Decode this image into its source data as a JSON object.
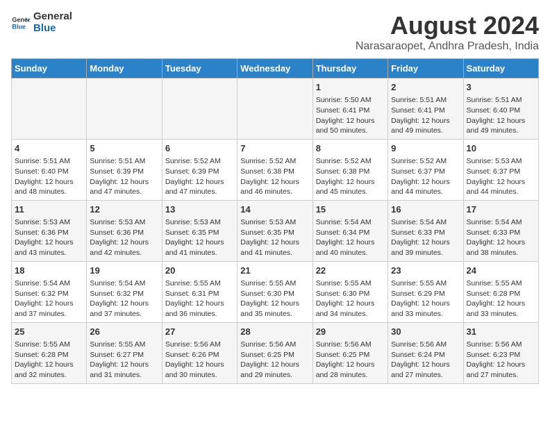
{
  "logo": {
    "line1": "General",
    "line2": "Blue"
  },
  "title": "August 2024",
  "subtitle": "Narasaraopet, Andhra Pradesh, India",
  "headers": [
    "Sunday",
    "Monday",
    "Tuesday",
    "Wednesday",
    "Thursday",
    "Friday",
    "Saturday"
  ],
  "weeks": [
    [
      {
        "day": "",
        "content": ""
      },
      {
        "day": "",
        "content": ""
      },
      {
        "day": "",
        "content": ""
      },
      {
        "day": "",
        "content": ""
      },
      {
        "day": "1",
        "content": "Sunrise: 5:50 AM\nSunset: 6:41 PM\nDaylight: 12 hours\nand 50 minutes."
      },
      {
        "day": "2",
        "content": "Sunrise: 5:51 AM\nSunset: 6:41 PM\nDaylight: 12 hours\nand 49 minutes."
      },
      {
        "day": "3",
        "content": "Sunrise: 5:51 AM\nSunset: 6:40 PM\nDaylight: 12 hours\nand 49 minutes."
      }
    ],
    [
      {
        "day": "4",
        "content": "Sunrise: 5:51 AM\nSunset: 6:40 PM\nDaylight: 12 hours\nand 48 minutes."
      },
      {
        "day": "5",
        "content": "Sunrise: 5:51 AM\nSunset: 6:39 PM\nDaylight: 12 hours\nand 47 minutes."
      },
      {
        "day": "6",
        "content": "Sunrise: 5:52 AM\nSunset: 6:39 PM\nDaylight: 12 hours\nand 47 minutes."
      },
      {
        "day": "7",
        "content": "Sunrise: 5:52 AM\nSunset: 6:38 PM\nDaylight: 12 hours\nand 46 minutes."
      },
      {
        "day": "8",
        "content": "Sunrise: 5:52 AM\nSunset: 6:38 PM\nDaylight: 12 hours\nand 45 minutes."
      },
      {
        "day": "9",
        "content": "Sunrise: 5:52 AM\nSunset: 6:37 PM\nDaylight: 12 hours\nand 44 minutes."
      },
      {
        "day": "10",
        "content": "Sunrise: 5:53 AM\nSunset: 6:37 PM\nDaylight: 12 hours\nand 44 minutes."
      }
    ],
    [
      {
        "day": "11",
        "content": "Sunrise: 5:53 AM\nSunset: 6:36 PM\nDaylight: 12 hours\nand 43 minutes."
      },
      {
        "day": "12",
        "content": "Sunrise: 5:53 AM\nSunset: 6:36 PM\nDaylight: 12 hours\nand 42 minutes."
      },
      {
        "day": "13",
        "content": "Sunrise: 5:53 AM\nSunset: 6:35 PM\nDaylight: 12 hours\nand 41 minutes."
      },
      {
        "day": "14",
        "content": "Sunrise: 5:53 AM\nSunset: 6:35 PM\nDaylight: 12 hours\nand 41 minutes."
      },
      {
        "day": "15",
        "content": "Sunrise: 5:54 AM\nSunset: 6:34 PM\nDaylight: 12 hours\nand 40 minutes."
      },
      {
        "day": "16",
        "content": "Sunrise: 5:54 AM\nSunset: 6:33 PM\nDaylight: 12 hours\nand 39 minutes."
      },
      {
        "day": "17",
        "content": "Sunrise: 5:54 AM\nSunset: 6:33 PM\nDaylight: 12 hours\nand 38 minutes."
      }
    ],
    [
      {
        "day": "18",
        "content": "Sunrise: 5:54 AM\nSunset: 6:32 PM\nDaylight: 12 hours\nand 37 minutes."
      },
      {
        "day": "19",
        "content": "Sunrise: 5:54 AM\nSunset: 6:32 PM\nDaylight: 12 hours\nand 37 minutes."
      },
      {
        "day": "20",
        "content": "Sunrise: 5:55 AM\nSunset: 6:31 PM\nDaylight: 12 hours\nand 36 minutes."
      },
      {
        "day": "21",
        "content": "Sunrise: 5:55 AM\nSunset: 6:30 PM\nDaylight: 12 hours\nand 35 minutes."
      },
      {
        "day": "22",
        "content": "Sunrise: 5:55 AM\nSunset: 6:30 PM\nDaylight: 12 hours\nand 34 minutes."
      },
      {
        "day": "23",
        "content": "Sunrise: 5:55 AM\nSunset: 6:29 PM\nDaylight: 12 hours\nand 33 minutes."
      },
      {
        "day": "24",
        "content": "Sunrise: 5:55 AM\nSunset: 6:28 PM\nDaylight: 12 hours\nand 33 minutes."
      }
    ],
    [
      {
        "day": "25",
        "content": "Sunrise: 5:55 AM\nSunset: 6:28 PM\nDaylight: 12 hours\nand 32 minutes."
      },
      {
        "day": "26",
        "content": "Sunrise: 5:55 AM\nSunset: 6:27 PM\nDaylight: 12 hours\nand 31 minutes."
      },
      {
        "day": "27",
        "content": "Sunrise: 5:56 AM\nSunset: 6:26 PM\nDaylight: 12 hours\nand 30 minutes."
      },
      {
        "day": "28",
        "content": "Sunrise: 5:56 AM\nSunset: 6:25 PM\nDaylight: 12 hours\nand 29 minutes."
      },
      {
        "day": "29",
        "content": "Sunrise: 5:56 AM\nSunset: 6:25 PM\nDaylight: 12 hours\nand 28 minutes."
      },
      {
        "day": "30",
        "content": "Sunrise: 5:56 AM\nSunset: 6:24 PM\nDaylight: 12 hours\nand 27 minutes."
      },
      {
        "day": "31",
        "content": "Sunrise: 5:56 AM\nSunset: 6:23 PM\nDaylight: 12 hours\nand 27 minutes."
      }
    ]
  ]
}
